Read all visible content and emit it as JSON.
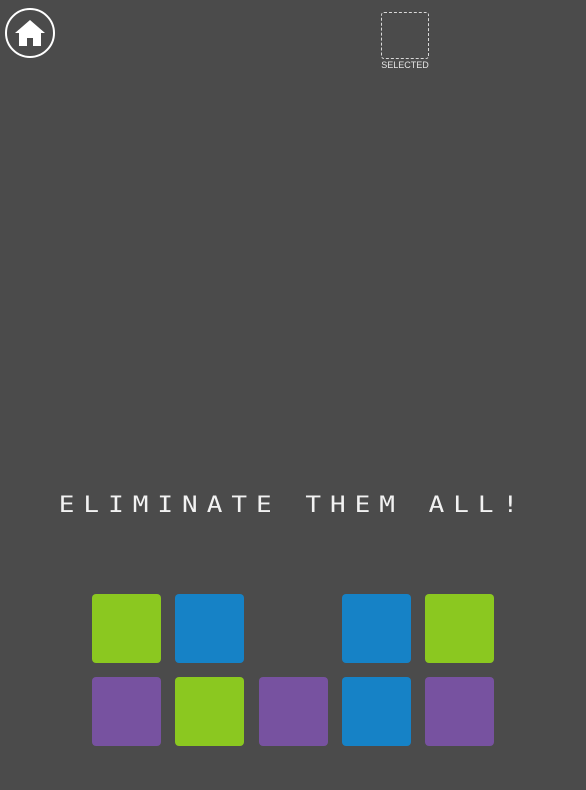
{
  "header": {
    "home_icon": "home-icon",
    "selected_label": "SELECTED"
  },
  "message": "ELIMINATE THEM ALL!",
  "colors": {
    "background": "#4b4b4b",
    "green": "#8bc820",
    "blue": "#1682c6",
    "purple": "#7752a0"
  },
  "board": {
    "rows": [
      [
        "green",
        "blue",
        null,
        "blue",
        "green"
      ],
      [
        "purple",
        "green",
        "purple",
        "blue",
        "purple"
      ]
    ]
  }
}
